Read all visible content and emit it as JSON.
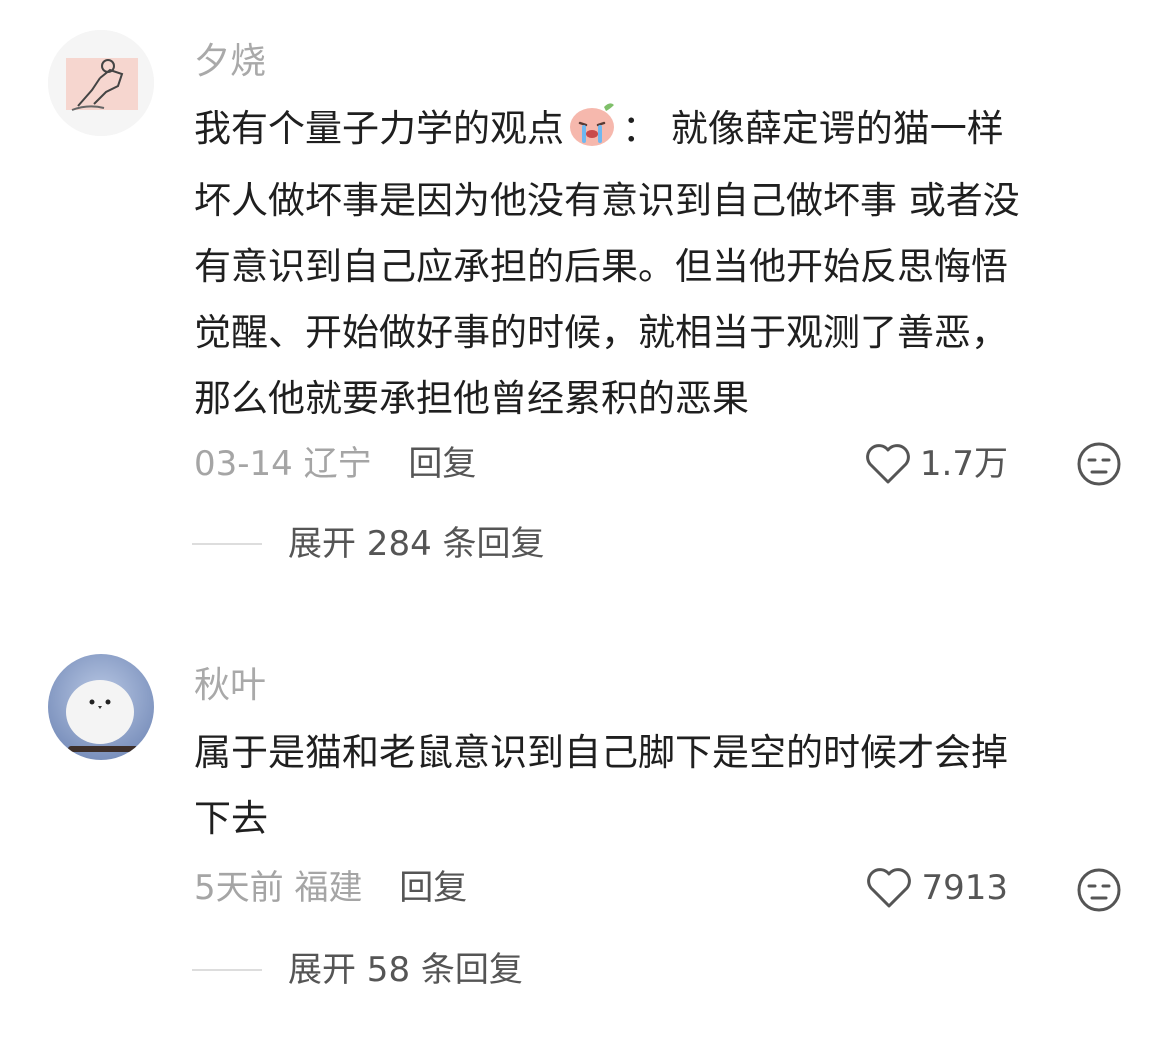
{
  "comments": [
    {
      "username": "夕烧",
      "text_lines": [
        "我有个量子力学的观点",
        "： 就像薛定谔的猫一样",
        "坏人做坏事是因为他没有意识到自己做坏事 或者没",
        "有意识到自己应承担的后果。但当他开始反思悔悟",
        "觉醒、开始做好事的时候，就相当于观测了善恶，",
        "那么他就要承担他曾经累积的恶果"
      ],
      "emoji": "crying-peach-emoji",
      "date": "03-14",
      "location": "辽宁",
      "reply_label": "回复",
      "likes": "1.7万",
      "expand_label": "展开 284 条回复"
    },
    {
      "username": "秋叶",
      "text_lines": [
        "属于是猫和老鼠意识到自己脚下是空的时候才会掉",
        "下去"
      ],
      "date": "5天前",
      "location": "福建",
      "reply_label": "回复",
      "likes": "7913",
      "expand_label": "展开 58 条回复"
    }
  ],
  "colors": {
    "meta_gray": "#a5a5a5",
    "text": "#1f1f1f",
    "action_gray": "#555555"
  }
}
